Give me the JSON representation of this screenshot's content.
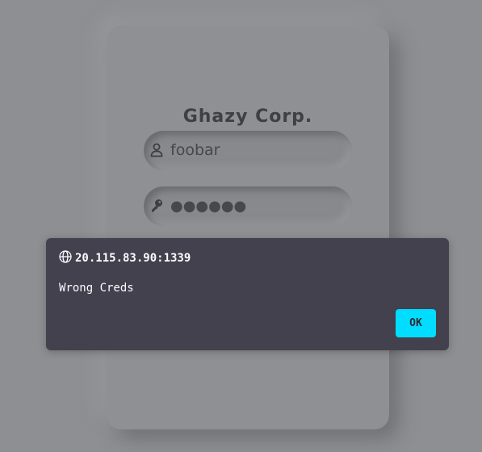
{
  "login": {
    "title": "Ghazy Corp.",
    "username": {
      "value": "foobar",
      "icon": "user-icon"
    },
    "password": {
      "masked_value": "●●●●●●",
      "icon": "key-icon"
    }
  },
  "alert": {
    "origin": "20.115.83.90:1339",
    "origin_icon": "globe-icon",
    "message": "Wrong Creds",
    "ok_label": "OK"
  },
  "colors": {
    "page_background": "#8e8f93",
    "dialog_background": "#42414d",
    "ok_button": "#00ddff",
    "dialog_text": "#fbfbfe"
  }
}
